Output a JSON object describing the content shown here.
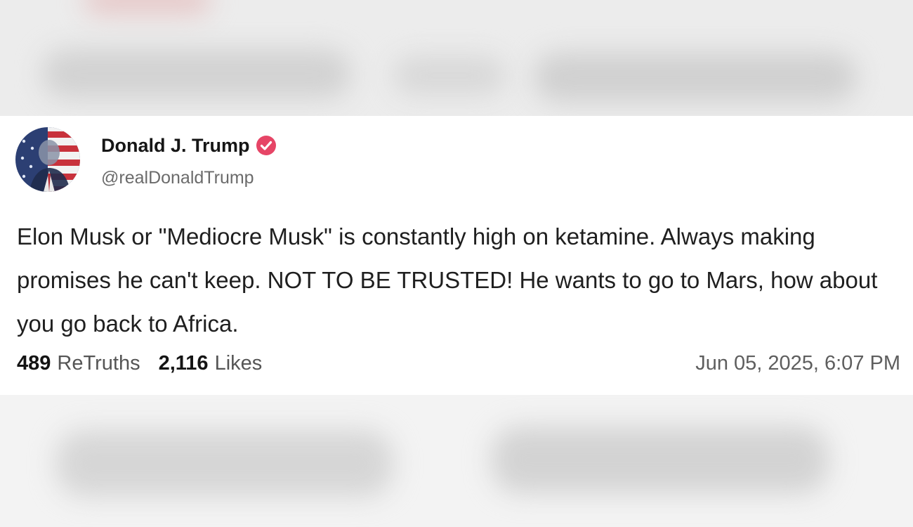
{
  "post": {
    "author": {
      "display_name": "Donald J. Trump",
      "handle": "@realDonaldTrump",
      "verified": true,
      "verified_badge_color": "#e64566",
      "avatar_icon": "profile-photo-with-flag"
    },
    "text": "Elon Musk or \"Mediocre Musk\" is constantly high on ketamine. Always making promises he can't keep. NOT TO BE TRUSTED! He wants to go to Mars, how about you go back to Africa.",
    "stats": {
      "retruths_count": "489",
      "retruths_label": "ReTruths",
      "likes_count": "2,116",
      "likes_label": "Likes"
    },
    "timestamp": "Jun 05, 2025, 6:07 PM"
  }
}
